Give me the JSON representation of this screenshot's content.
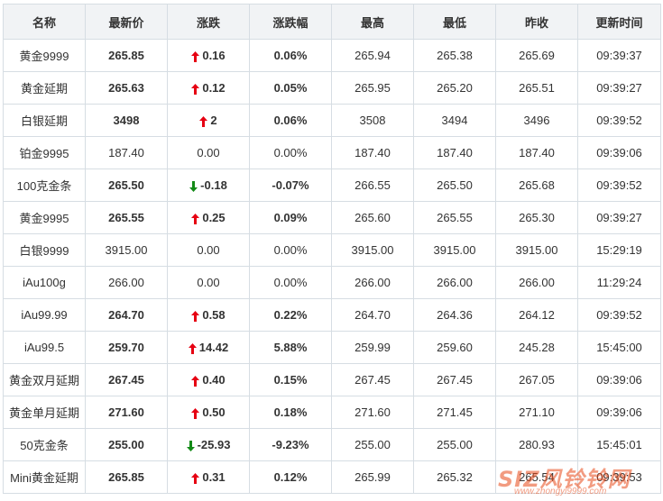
{
  "headers": [
    "名称",
    "最新价",
    "涨跌",
    "涨跌幅",
    "最高",
    "最低",
    "昨收",
    "更新时间"
  ],
  "colors": {
    "up": "#e60012",
    "down": "#138a17",
    "name": "#1a5a9a"
  },
  "rows": [
    {
      "name": "黄金9999",
      "latest": "265.85",
      "change": "0.16",
      "pct": "0.06%",
      "high": "265.94",
      "low": "265.38",
      "prev_close": "265.69",
      "time": "09:39:37",
      "trend": "up"
    },
    {
      "name": "黄金延期",
      "latest": "265.63",
      "change": "0.12",
      "pct": "0.05%",
      "high": "265.95",
      "low": "265.20",
      "prev_close": "265.51",
      "time": "09:39:27",
      "trend": "up"
    },
    {
      "name": "白银延期",
      "latest": "3498",
      "change": "2",
      "pct": "0.06%",
      "high": "3508",
      "low": "3494",
      "prev_close": "3496",
      "time": "09:39:52",
      "trend": "up"
    },
    {
      "name": "铂金9995",
      "latest": "187.40",
      "change": "0.00",
      "pct": "0.00%",
      "high": "187.40",
      "low": "187.40",
      "prev_close": "187.40",
      "time": "09:39:06",
      "trend": "flat"
    },
    {
      "name": "100克金条",
      "latest": "265.50",
      "change": "-0.18",
      "pct": "-0.07%",
      "high": "266.55",
      "low": "265.50",
      "prev_close": "265.68",
      "time": "09:39:52",
      "trend": "down"
    },
    {
      "name": "黄金9995",
      "latest": "265.55",
      "change": "0.25",
      "pct": "0.09%",
      "high": "265.60",
      "low": "265.55",
      "prev_close": "265.30",
      "time": "09:39:27",
      "trend": "up"
    },
    {
      "name": "白银9999",
      "latest": "3915.00",
      "change": "0.00",
      "pct": "0.00%",
      "high": "3915.00",
      "low": "3915.00",
      "prev_close": "3915.00",
      "time": "15:29:19",
      "trend": "flat"
    },
    {
      "name": "iAu100g",
      "latest": "266.00",
      "change": "0.00",
      "pct": "0.00%",
      "high": "266.00",
      "low": "266.00",
      "prev_close": "266.00",
      "time": "11:29:24",
      "trend": "flat"
    },
    {
      "name": "iAu99.99",
      "latest": "264.70",
      "change": "0.58",
      "pct": "0.22%",
      "high": "264.70",
      "low": "264.36",
      "prev_close": "264.12",
      "time": "09:39:52",
      "trend": "up"
    },
    {
      "name": "iAu99.5",
      "latest": "259.70",
      "change": "14.42",
      "pct": "5.88%",
      "high": "259.99",
      "low": "259.60",
      "prev_close": "245.28",
      "time": "15:45:00",
      "trend": "up"
    },
    {
      "name": "黄金双月延期",
      "latest": "267.45",
      "change": "0.40",
      "pct": "0.15%",
      "high": "267.45",
      "low": "267.45",
      "prev_close": "267.05",
      "time": "09:39:06",
      "trend": "up"
    },
    {
      "name": "黄金单月延期",
      "latest": "271.60",
      "change": "0.50",
      "pct": "0.18%",
      "high": "271.60",
      "low": "271.45",
      "prev_close": "271.10",
      "time": "09:39:06",
      "trend": "up"
    },
    {
      "name": "50克金条",
      "latest": "255.00",
      "change": "-25.93",
      "pct": "-9.23%",
      "high": "255.00",
      "low": "255.00",
      "prev_close": "280.93",
      "time": "15:45:01",
      "trend": "down"
    },
    {
      "name": "Mini黄金延期",
      "latest": "265.85",
      "change": "0.31",
      "pct": "0.12%",
      "high": "265.99",
      "low": "265.32",
      "prev_close": "265.54",
      "time": "09:39:53",
      "trend": "up"
    }
  ],
  "watermark": {
    "logo": "SIZ风铃铃网",
    "url": "www.zhongyi9999.com"
  }
}
